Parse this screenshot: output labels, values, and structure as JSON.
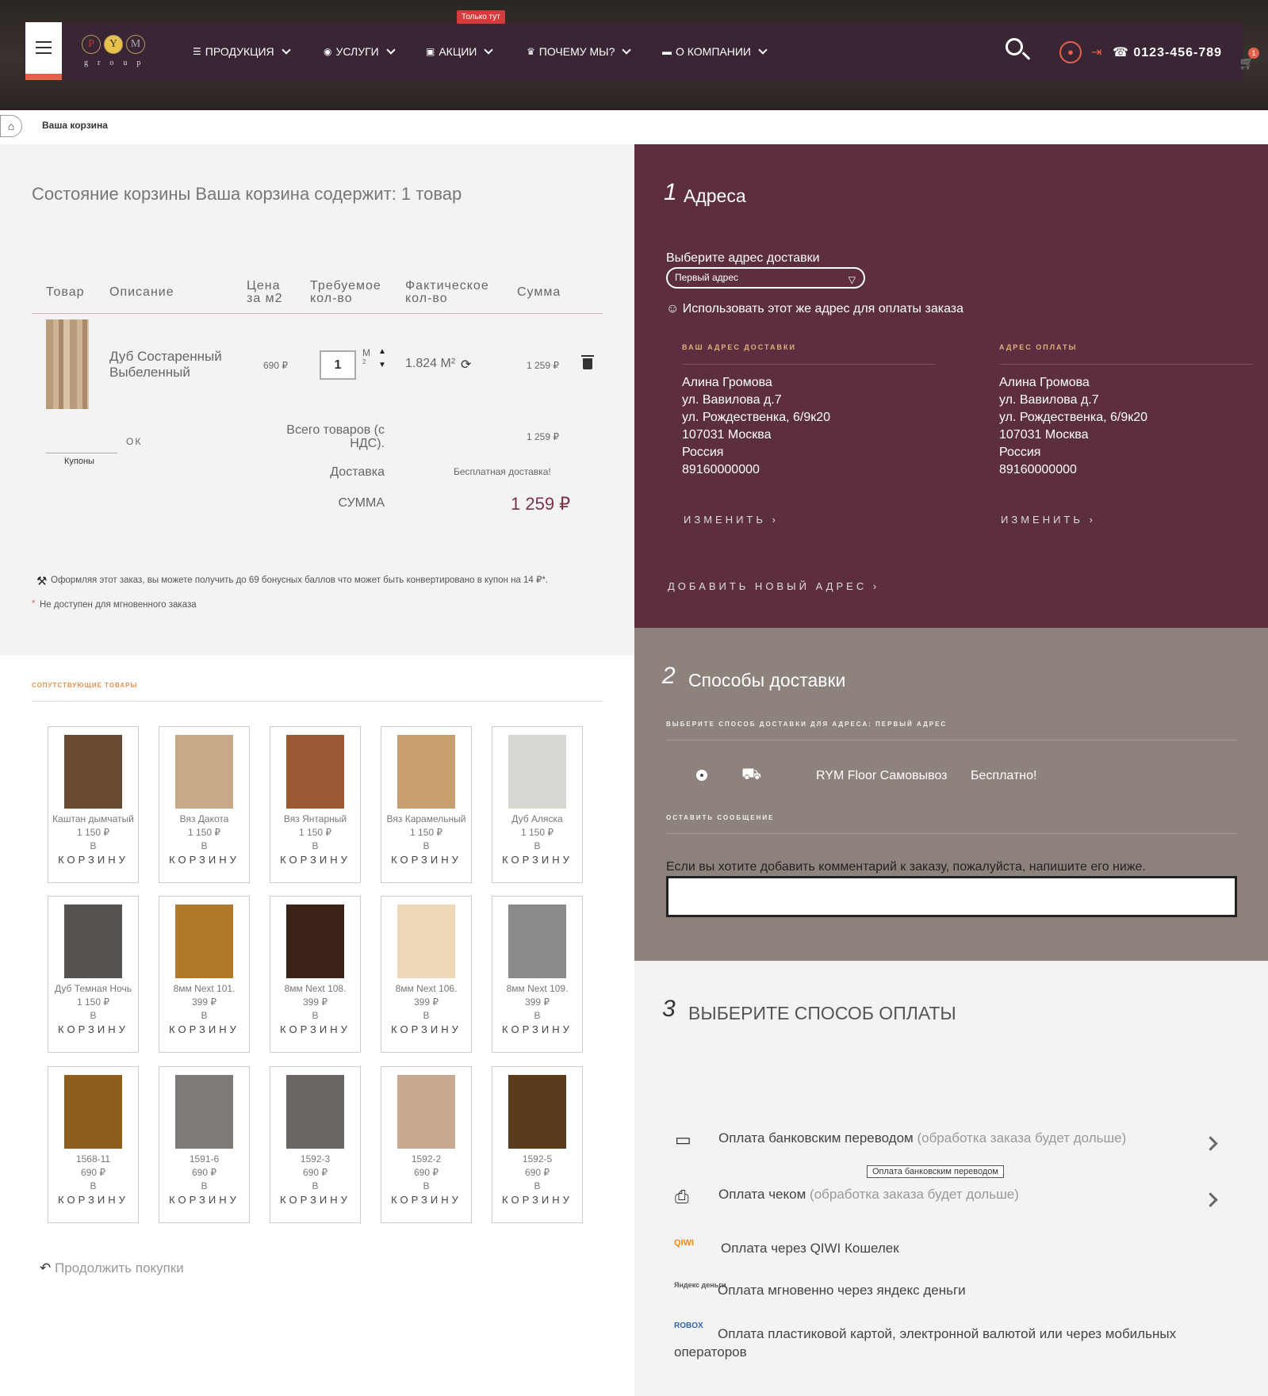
{
  "header": {
    "logo_letters": [
      "P",
      "Y",
      "M"
    ],
    "logo_sub": "group",
    "badge": "Только тут",
    "nav": [
      {
        "icon": "list-icon",
        "label": "ПРОДУКЦИЯ"
      },
      {
        "icon": "eye-icon",
        "label": "УСЛУГИ"
      },
      {
        "icon": "gift-icon",
        "label": "АКЦИИ"
      },
      {
        "icon": "trophy-icon",
        "label": "ПОЧЕМУ МЫ?"
      },
      {
        "icon": "briefcase-icon",
        "label": "О КОМПАНИИ"
      }
    ],
    "phone": "☎ 0123-456-789",
    "cart_count": "1"
  },
  "breadcrumb": {
    "current": "Ваша корзина"
  },
  "cart": {
    "title": "Состояние корзины Ваша корзина содержит: 1 товар",
    "columns": {
      "product": "Товар",
      "description": "Описание",
      "price": "Цена\nза м2",
      "required": "Требуемое\nкол-во",
      "actual": "Фактическое\nкол-во",
      "sum": "Сумма"
    },
    "item": {
      "name": "Дуб Состаренный Выбеленный",
      "price": "690 ₽",
      "qty": "1",
      "unit": "М",
      "unit_sup": "2",
      "actual": "1.824 М²",
      "sum": "1 259 ₽"
    },
    "coupon_ok": "ОК",
    "coupon_label": "Купоны",
    "subtotal_label": "Всего товаров (с НДС).",
    "subtotal": "1 259 ₽",
    "delivery_label": "Доставка",
    "delivery": "Бесплатная доставка!",
    "total_label": "СУММА",
    "total": "1 259 ₽",
    "bonus_note": "Оформляя этот заказ, вы можете получить до 69 бонусных баллов что может быть конвертировано в купон на 14 ₽*.",
    "star_note": "Не доступен для мгновенного заказа"
  },
  "related": {
    "title": "СОПУТСТВУЮЩИЕ ТОВАРЫ",
    "to_cart_word": "В",
    "to_cart": "КОРЗИНУ",
    "items": [
      {
        "name": "Каштан дымчатый",
        "price": "1 150 ₽"
      },
      {
        "name": "Вяз Дакота",
        "price": "1 150 ₽"
      },
      {
        "name": "Вяз Янтарный",
        "price": "1 150 ₽"
      },
      {
        "name": "Вяз Карамельный",
        "price": "1 150 ₽"
      },
      {
        "name": "Дуб Аляска",
        "price": "1 150 ₽"
      },
      {
        "name": "Дуб Темная Ночь",
        "price": "1 150 ₽"
      },
      {
        "name": "8мм Next 101.",
        "price": "399 ₽"
      },
      {
        "name": "8мм Next 108.",
        "price": "399 ₽"
      },
      {
        "name": "8мм Next 106.",
        "price": "399 ₽"
      },
      {
        "name": "8мм Next 109.",
        "price": "399 ₽"
      },
      {
        "name": "1568-11",
        "price": "690 ₽"
      },
      {
        "name": "1591-6",
        "price": "690 ₽"
      },
      {
        "name": "1592-3",
        "price": "690 ₽"
      },
      {
        "name": "1592-2",
        "price": "690 ₽"
      },
      {
        "name": "1592-5",
        "price": "690 ₽"
      }
    ],
    "colors": [
      "#6b4a32",
      "#c9a888",
      "#9a5a34",
      "#c8a070",
      "#d6d8d2",
      "#55524f",
      "#b07a2a",
      "#3a2218",
      "#eed8b8",
      "#8a8a88",
      "#8e5e1c",
      "#7e7a78",
      "#6a6462",
      "#c8a890",
      "#5c3a1c"
    ],
    "continue": "Продолжить покупки"
  },
  "addresses": {
    "num": "1",
    "title": "Адреса",
    "choose_label": "Выберите адрес доставки",
    "selected": "Первый адрес",
    "same_addr": "☺ Использовать этот же адрес для оплаты заказа",
    "delivery_h": "ВАШ АДРЕС ДОСТАВКИ",
    "billing_h": "АДРЕС ОПЛАТЫ",
    "lines": [
      "Алина Громова",
      "ул. Вавилова д.7",
      "ул. Рождественка, 6/9к20",
      "107031 Москва",
      "Россия",
      "89160000000"
    ],
    "change": "ИЗМЕНИТЬ",
    "add_new": "ДОБАВИТЬ НОВЫЙ АДРЕС"
  },
  "shipping": {
    "num": "2",
    "title": "Способы доставки",
    "caption": "ВЫБЕРИТЕ СПОСОБ ДОСТАВКИ ДЛЯ АДРЕСА: ПЕРВЫЙ АДРЕС",
    "carrier": "RYM Floor Самовывоз",
    "cost": "Бесплатно!",
    "msg_caption": "ОСТАВИТЬ СООБЩЕНИЕ",
    "msg_label": "Если вы хотите добавить комментарий к заказу, пожалуйста, напишите его ниже."
  },
  "payment": {
    "num": "3",
    "title": "ВЫБЕРИТЕ СПОСОБ ОПЛАТЫ",
    "bank": "Оплата банковским переводом",
    "bank_note": "(обработка заказа будет дольше)",
    "tooltip": "Оплата банковским переводом",
    "cheque": "Оплата чеком",
    "cheque_note": "(обработка заказа будет дольше)",
    "qiwi": "Оплата через QIWI Кошелек",
    "qiwi_logo": "QIWI",
    "yandex": "Оплата мгновенно через яндекс деньги",
    "yandex_logo": "Яндекс деньги",
    "robox": "Оплата пластиковой картой, электронной валютой или через мобильных операторов",
    "robox_logo": "ROBOX"
  }
}
